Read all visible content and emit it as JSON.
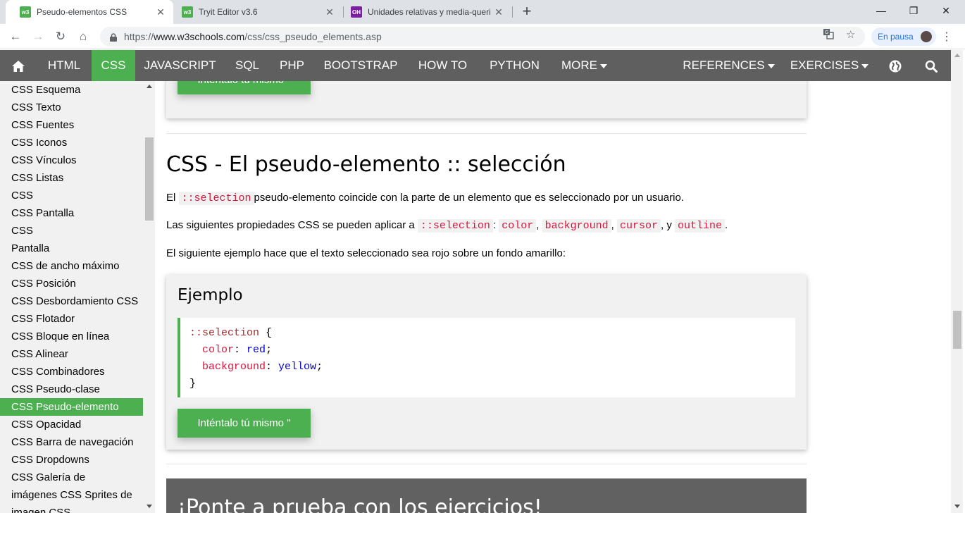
{
  "browser": {
    "tabs": [
      {
        "title": "Pseudo-elementos CSS",
        "favicon": "w3schools-icon",
        "active": true
      },
      {
        "title": "Tryit Editor v3.6",
        "favicon": "w3schools-icon",
        "active": false
      },
      {
        "title": "Unidades relativas y media-queri",
        "favicon": "oh-icon",
        "active": false
      }
    ],
    "new_tab": "+",
    "window_controls": {
      "minimize": "—",
      "restore": "❐",
      "close": "✕"
    },
    "url": {
      "scheme": "https://",
      "host": "www.w3schools.com",
      "path": "/css/css_pseudo_elements.asp"
    },
    "pause_label": "En pausa"
  },
  "topnav": {
    "items": [
      "HTML",
      "CSS",
      "JAVASCRIPT",
      "SQL",
      "PHP",
      "BOOTSTRAP",
      "HOW TO",
      "PYTHON",
      "MORE",
      "REFERENCES",
      "EXERCISES"
    ],
    "active": "CSS",
    "accent": "#4caf50",
    "bg": "#5f5f5f"
  },
  "sidebar": {
    "items": [
      "CSS Esquema",
      "CSS Texto",
      "CSS Fuentes",
      "CSS Iconos",
      "CSS Vínculos",
      "CSS Listas",
      "CSS",
      "CSS Pantalla",
      "CSS",
      "Pantalla",
      "CSS de ancho máximo",
      "CSS Posición",
      "CSS Desbordamiento CSS",
      "CSS Flotador",
      "CSS Bloque en línea",
      "CSS Alinear",
      "CSS Combinadores",
      "CSS Pseudo-clase",
      "CSS Pseudo-elemento",
      "CSS Opacidad",
      "CSS Barra de navegación",
      "CSS Dropdowns",
      "CSS Galería de",
      "imágenes CSS Sprites de",
      "imagen CSS"
    ],
    "active_index": 18
  },
  "main": {
    "try_button": "Inténtalo tú mismo \"",
    "section_title": "CSS - El pseudo-elemento :: selección",
    "p1": {
      "pre": "El ",
      "code": "::selection",
      "post": "pseudo-elemento coincide con la parte de un elemento que es seleccionado por un usuario."
    },
    "p2": {
      "pre": "Las siguientes propiedades CSS se pueden aplicar a ",
      "code1": "::selection",
      "sep1": ": ",
      "code2": "color",
      "sep2": ", ",
      "code3": "background",
      "sep3": ", ",
      "code4": "cursor",
      "sep4": ", y ",
      "code5": "outline",
      "end": "."
    },
    "p3": "El siguiente ejemplo hace que el texto seleccionado sea rojo sobre un fondo amarillo:",
    "example": {
      "title": "Ejemplo",
      "code": {
        "selector": "::selection",
        "open": " {",
        "prop1": "color",
        "val1": "red",
        "prop2": "background",
        "val2": "yellow",
        "close": "}"
      },
      "try_button": "Inténtalo tú mismo \""
    },
    "exercise_title": "¡Ponte a prueba con los ejercicios!"
  }
}
